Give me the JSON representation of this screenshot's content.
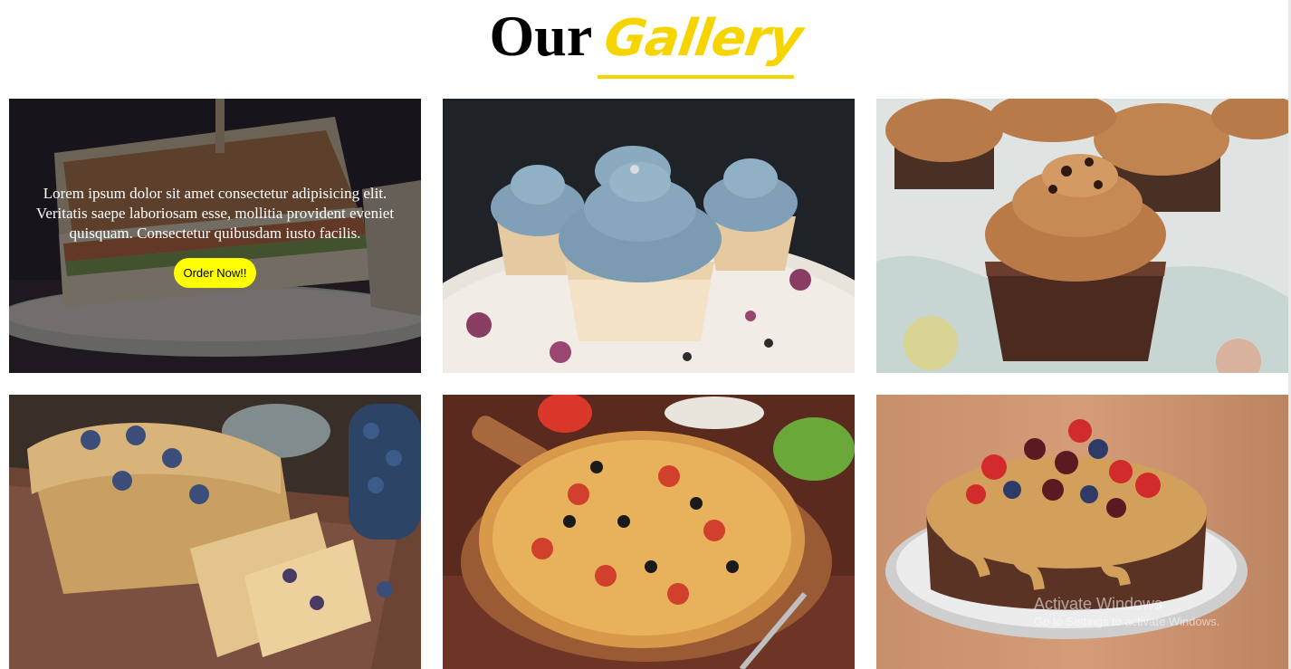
{
  "header": {
    "title_plain": "Our",
    "title_accent": "Gallery"
  },
  "colors": {
    "accent": "#f5d400",
    "button_bg": "#ffff00",
    "overlay": "rgba(18,16,22,0.55)"
  },
  "gallery": {
    "items": [
      {
        "subject": "sandwich",
        "overlay_visible": true
      },
      {
        "subject": "blue-frosted-cupcakes",
        "overlay_visible": false
      },
      {
        "subject": "chocolate-cupcakes",
        "overlay_visible": false
      },
      {
        "subject": "blueberry-oat-loaf",
        "overlay_visible": false
      },
      {
        "subject": "pizza",
        "overlay_visible": false
      },
      {
        "subject": "berry-caramel-cake",
        "overlay_visible": false
      }
    ],
    "overlay_text": "Lorem ipsum dolor sit amet consectetur adipisicing elit. Veritatis saepe laboriosam esse, mollitia provident eveniet quisquam. Consectetur quibusdam iusto facilis.",
    "order_button_label": "Order Now!!"
  },
  "watermark": {
    "line1": "Activate Windows",
    "line2": "Go to Settings to activate Windows."
  }
}
